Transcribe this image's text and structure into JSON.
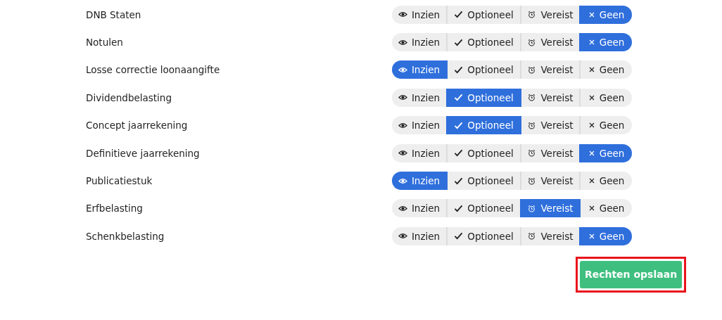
{
  "rows": [
    {
      "name": "DNB Staten",
      "options": [
        {
          "kind": "view",
          "label": "Inzien",
          "selected": false
        },
        {
          "kind": "optional",
          "label": "Optioneel",
          "selected": false
        },
        {
          "kind": "required",
          "label": "Vereist",
          "selected": false
        },
        {
          "kind": "none",
          "label": "Geen",
          "selected": true
        }
      ]
    },
    {
      "name": "Notulen",
      "options": [
        {
          "kind": "view",
          "label": "Inzien",
          "selected": false
        },
        {
          "kind": "optional",
          "label": "Optioneel",
          "selected": false
        },
        {
          "kind": "required",
          "label": "Vereist",
          "selected": false
        },
        {
          "kind": "none",
          "label": "Geen",
          "selected": true
        }
      ]
    },
    {
      "name": "Losse correctie loonaangifte",
      "options": [
        {
          "kind": "view",
          "label": "Inzien",
          "selected": true
        },
        {
          "kind": "optional",
          "label": "Optioneel",
          "selected": false
        },
        {
          "kind": "required",
          "label": "Vereist",
          "selected": false
        },
        {
          "kind": "none",
          "label": "Geen",
          "selected": false
        }
      ]
    },
    {
      "name": "Dividendbelasting",
      "options": [
        {
          "kind": "view",
          "label": "Inzien",
          "selected": false
        },
        {
          "kind": "optional",
          "label": "Optioneel",
          "selected": true
        },
        {
          "kind": "required",
          "label": "Vereist",
          "selected": false
        },
        {
          "kind": "none",
          "label": "Geen",
          "selected": false
        }
      ]
    },
    {
      "name": "Concept jaarrekening",
      "options": [
        {
          "kind": "view",
          "label": "Inzien",
          "selected": false
        },
        {
          "kind": "optional",
          "label": "Optioneel",
          "selected": true
        },
        {
          "kind": "required",
          "label": "Vereist",
          "selected": false
        },
        {
          "kind": "none",
          "label": "Geen",
          "selected": false
        }
      ]
    },
    {
      "name": "Definitieve jaarrekening",
      "options": [
        {
          "kind": "view",
          "label": "Inzien",
          "selected": false
        },
        {
          "kind": "optional",
          "label": "Optioneel",
          "selected": false
        },
        {
          "kind": "required",
          "label": "Vereist",
          "selected": false
        },
        {
          "kind": "none",
          "label": "Geen",
          "selected": true
        }
      ]
    },
    {
      "name": "Publicatiestuk",
      "options": [
        {
          "kind": "view",
          "label": "Inzien",
          "selected": true
        },
        {
          "kind": "optional",
          "label": "Optioneel",
          "selected": false
        },
        {
          "kind": "required",
          "label": "Vereist",
          "selected": false
        },
        {
          "kind": "none",
          "label": "Geen",
          "selected": false
        }
      ]
    },
    {
      "name": "Erfbelasting",
      "options": [
        {
          "kind": "view",
          "label": "Inzien",
          "selected": false
        },
        {
          "kind": "optional",
          "label": "Optioneel",
          "selected": false
        },
        {
          "kind": "required",
          "label": "Vereist",
          "selected": true
        },
        {
          "kind": "none",
          "label": "Geen",
          "selected": false
        }
      ]
    },
    {
      "name": "Schenkbelasting",
      "options": [
        {
          "kind": "view",
          "label": "Inzien",
          "selected": false
        },
        {
          "kind": "optional",
          "label": "Optioneel",
          "selected": false
        },
        {
          "kind": "required",
          "label": "Vereist",
          "selected": false
        },
        {
          "kind": "none",
          "label": "Geen",
          "selected": true
        }
      ]
    }
  ],
  "save_button": {
    "label": "Rechten opslaan",
    "highlighted": true
  }
}
